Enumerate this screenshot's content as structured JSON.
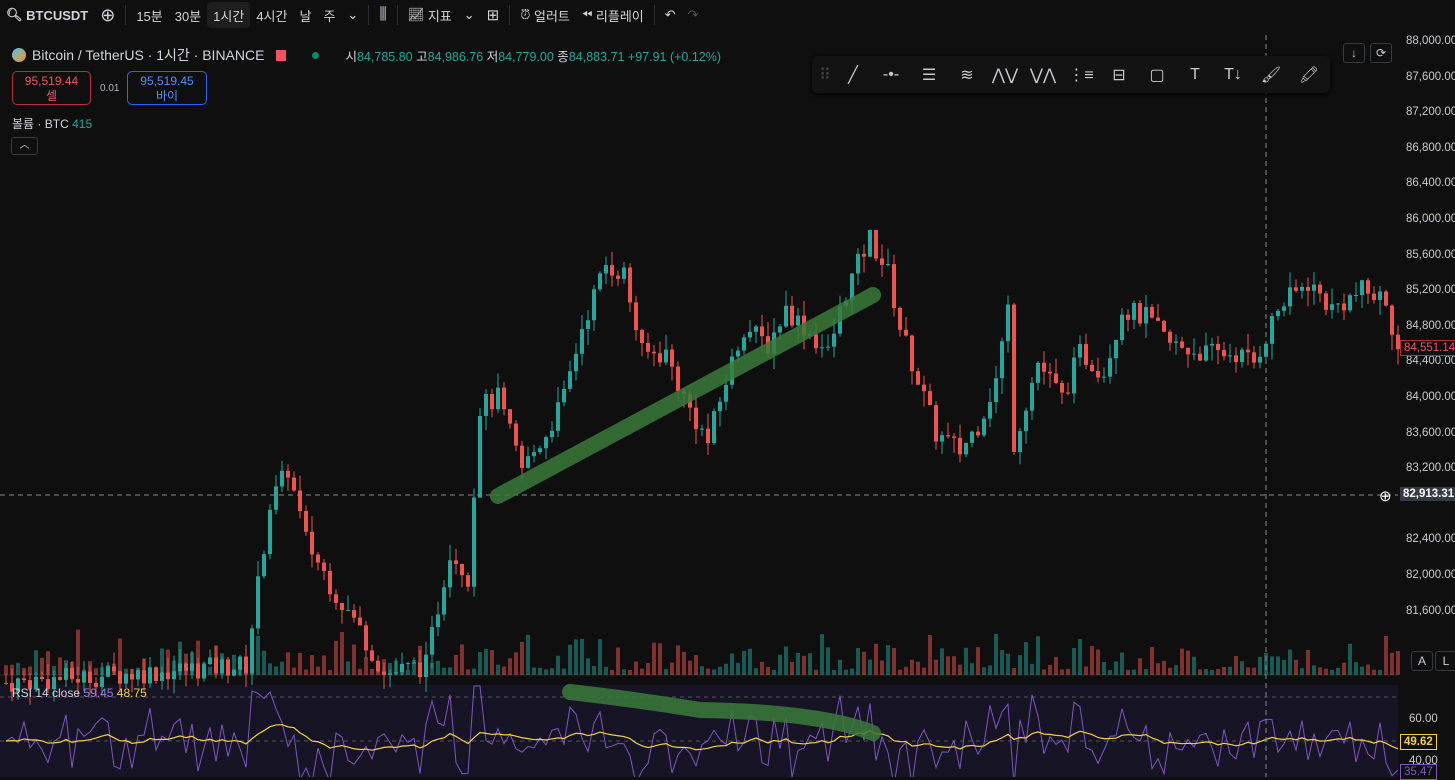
{
  "toolbar": {
    "symbol": "BTCUSDT",
    "intervals": [
      "15분",
      "30분",
      "1시간",
      "4시간",
      "날",
      "주"
    ],
    "active_interval": "1시간",
    "indicators": "지표",
    "alert": "얼러트",
    "replay": "리플레이"
  },
  "legend": {
    "title": "Bitcoin / TetherUS · 1시간 · BINANCE",
    "open_label": "시",
    "open": "84,785.80",
    "high_label": "고",
    "high": "84,986.76",
    "low_label": "저",
    "low": "84,779.00",
    "close_label": "종",
    "close": "84,883.71",
    "change": "+97.91 (+0.12%)"
  },
  "trade": {
    "sell_price": "95,519.44",
    "sell_label": "셀",
    "spread": "0.01",
    "buy_price": "95,519.45",
    "buy_label": "바이"
  },
  "volume": {
    "label": "볼륨 · BTC",
    "value": "415"
  },
  "price_axis": {
    "ticks": [
      "88,000.00",
      "87,600.00",
      "87,200.00",
      "86,800.00",
      "86,400.00",
      "86,000.00",
      "85,600.00",
      "85,200.00",
      "84,800.00",
      "84,400.00",
      "84,000.00",
      "83,600.00",
      "83,200.00",
      "82,400.00",
      "82,000.00",
      "81,600.00"
    ],
    "last_price": "84,551.14",
    "crosshair_price": "82,913.31",
    "auto_label": "A",
    "log_label": "L"
  },
  "rsi": {
    "label": "RSI 14 close",
    "value": "59.45",
    "ma": "48.75",
    "ticks": [
      "60.00",
      "40.00"
    ],
    "ma_tag": "49.62",
    "rsi_tag": "35.47"
  },
  "colors": {
    "up": "#26a69a",
    "down": "#ef5350",
    "rsi": "#7e57c2",
    "rsi_ma": "#f5d142",
    "drawing": "#3a7a3a"
  },
  "chart_data": {
    "type": "candlestick",
    "symbol": "BTCUSDT",
    "interval": "1h",
    "ylim": [
      81300,
      88000
    ],
    "anchors": [
      [
        0,
        80800
      ],
      [
        40,
        81000
      ],
      [
        44,
        82800
      ],
      [
        47,
        83200
      ],
      [
        50,
        82400
      ],
      [
        55,
        81800
      ],
      [
        59,
        81400
      ],
      [
        63,
        80900
      ],
      [
        70,
        81000
      ],
      [
        74,
        82300
      ],
      [
        77,
        82000
      ],
      [
        79,
        83900
      ],
      [
        82,
        84000
      ],
      [
        86,
        83200
      ],
      [
        90,
        83600
      ],
      [
        93,
        84000
      ],
      [
        96,
        84800
      ],
      [
        100,
        85500
      ],
      [
        103,
        85400
      ],
      [
        106,
        84500
      ],
      [
        110,
        84500
      ],
      [
        113,
        84000
      ],
      [
        117,
        83500
      ],
      [
        120,
        84200
      ],
      [
        123,
        84800
      ],
      [
        127,
        84600
      ],
      [
        130,
        85000
      ],
      [
        133,
        84800
      ],
      [
        137,
        84500
      ],
      [
        140,
        85200
      ],
      [
        144,
        85800
      ],
      [
        147,
        85400
      ],
      [
        149,
        84800
      ],
      [
        152,
        84200
      ],
      [
        155,
        83600
      ],
      [
        159,
        83400
      ],
      [
        162,
        83700
      ],
      [
        165,
        84200
      ],
      [
        167,
        85000
      ],
      [
        168,
        83500
      ],
      [
        172,
        84400
      ],
      [
        176,
        84000
      ],
      [
        179,
        84500
      ],
      [
        183,
        84300
      ],
      [
        186,
        85000
      ],
      [
        190,
        84900
      ],
      [
        194,
        84600
      ],
      [
        200,
        84500
      ],
      [
        205,
        84500
      ],
      [
        208,
        84400
      ],
      [
        212,
        85000
      ],
      [
        217,
        85300
      ],
      [
        221,
        85000
      ],
      [
        226,
        85200
      ],
      [
        230,
        85100
      ],
      [
        232,
        84550
      ]
    ],
    "rsi_ylim": [
      30,
      75
    ]
  }
}
